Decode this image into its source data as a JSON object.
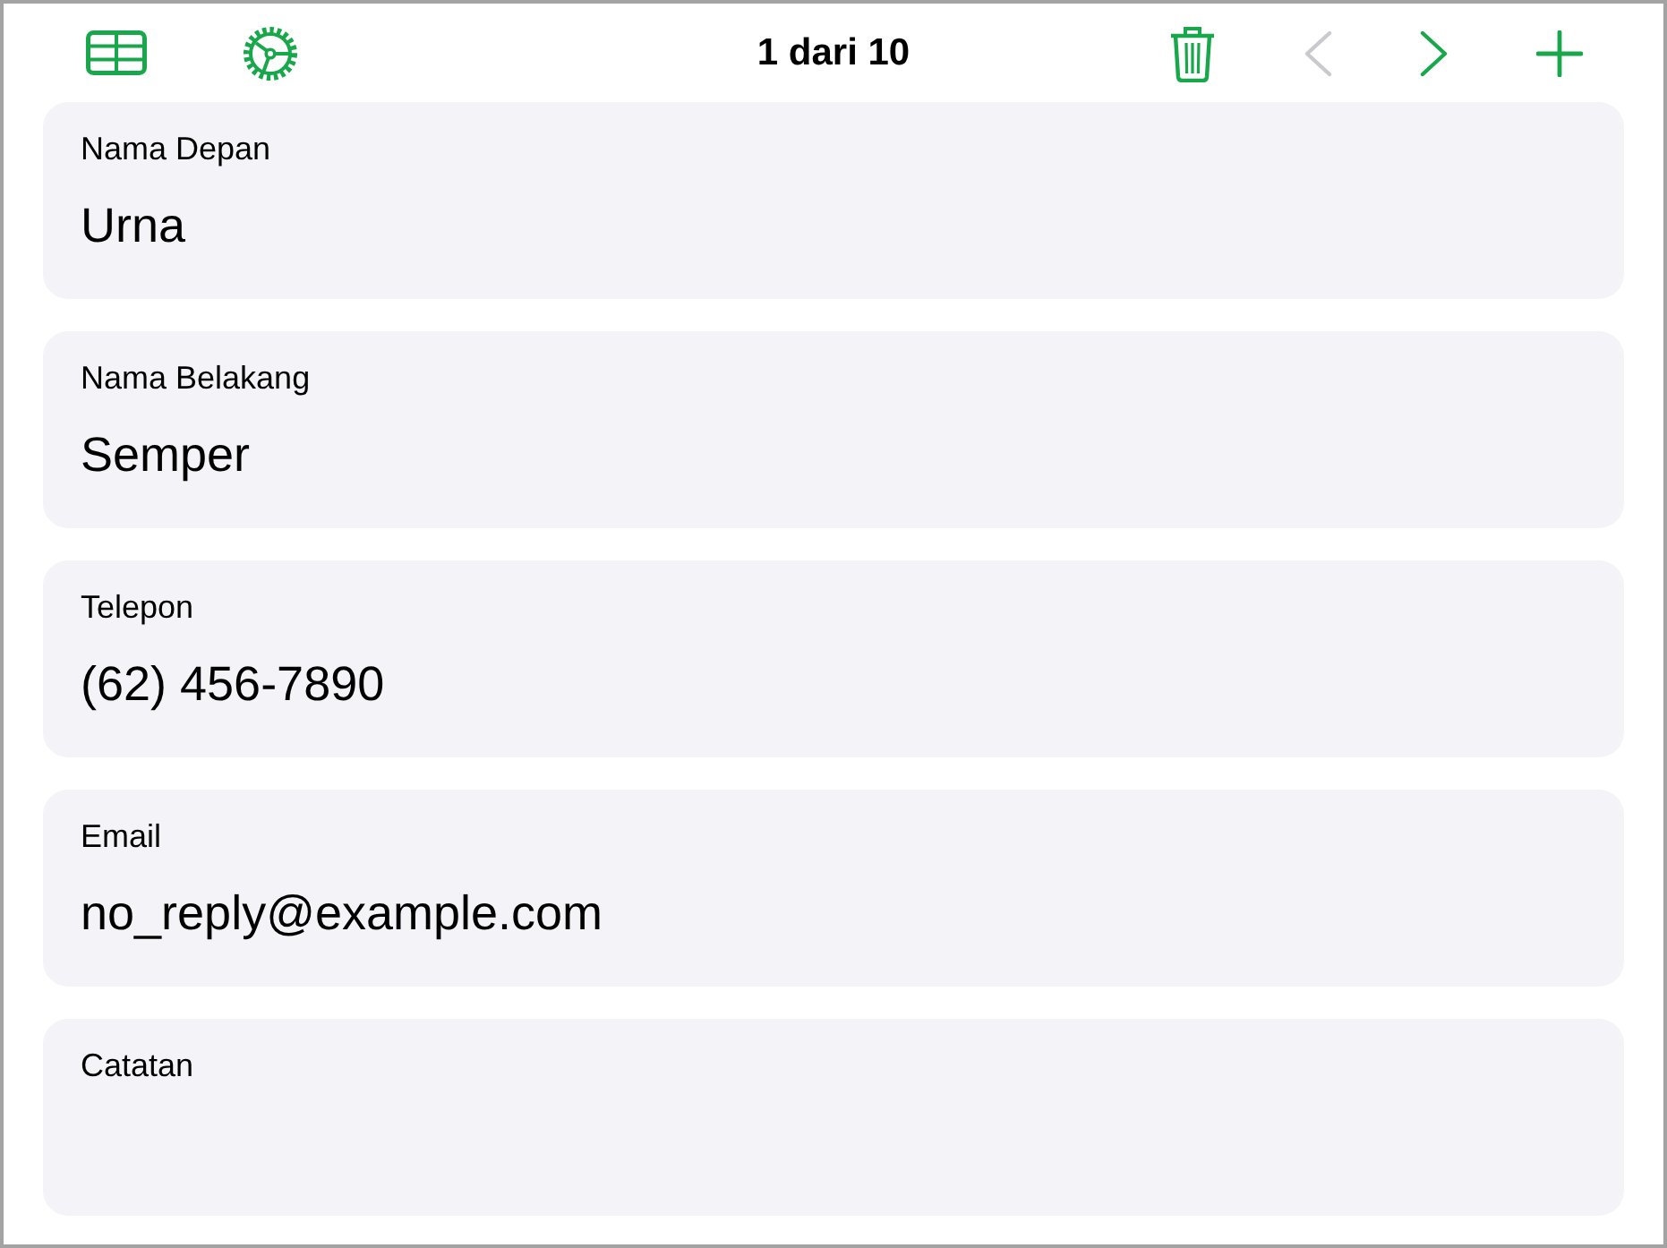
{
  "toolbar": {
    "title": "1 dari 10",
    "left_buttons": [
      {
        "kind": "table",
        "disabled": false
      },
      {
        "kind": "settings",
        "disabled": false
      }
    ],
    "right_buttons": [
      {
        "kind": "delete",
        "disabled": false
      },
      {
        "kind": "previous",
        "disabled": true
      },
      {
        "kind": "next",
        "disabled": false
      },
      {
        "kind": "add",
        "disabled": false
      }
    ]
  },
  "fields": [
    {
      "label": "Nama Depan",
      "value": "Urna"
    },
    {
      "label": "Nama Belakang",
      "value": "Semper"
    },
    {
      "label": "Telepon",
      "value": "(62) 456-7890"
    },
    {
      "label": "Email",
      "value": "no_reply@example.com"
    },
    {
      "label": "Catatan"
    }
  ]
}
